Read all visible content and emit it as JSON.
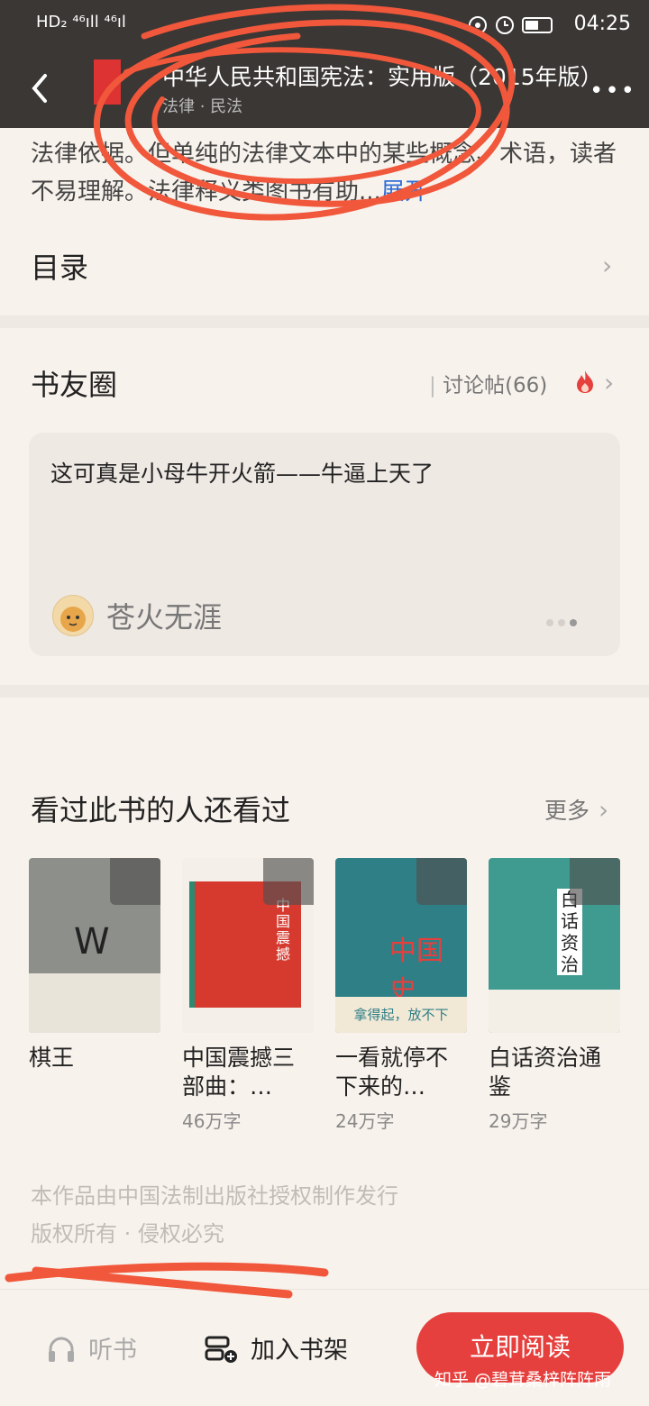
{
  "status_bar": {
    "left": "HD₂ ⁴⁶ıll ⁴⁶ıl",
    "time": "04:25",
    "icons": [
      "eye-icon",
      "alarm-icon",
      "battery-icon"
    ]
  },
  "header": {
    "title": "中华人民共和国宪法：实用版（2015年版）",
    "category": "法律 · 民法",
    "more_label": "•••"
  },
  "intro": {
    "text": "法律依据。但单纯的法律文本中的某些概念、术语，读者不易理解。法律释义类图书有助...",
    "expand_label": "展开"
  },
  "toc": {
    "label": "目录"
  },
  "book_circle": {
    "title": "书友圈",
    "discussion_label": "讨论帖(66)",
    "post": {
      "text": "这可真是小母牛开火箭——牛逼上天了",
      "user": "苍火无涯",
      "page_dots": 3,
      "active_dot": 2
    }
  },
  "recommendations": {
    "title": "看过此书的人还看过",
    "more_label": "更多",
    "books": [
      {
        "name": "棋王",
        "words": "",
        "cover_color": "#8d8f8b"
      },
      {
        "name": "中国震撼三部曲：…",
        "words": "46万字",
        "cover_color": "#d63a2f"
      },
      {
        "name": "一看就停不下来的…",
        "words": "24万字",
        "cover_color": "#2f7f86"
      },
      {
        "name": "白话资治通鉴",
        "words": "29万字",
        "cover_color": "#3f9a90"
      }
    ]
  },
  "copyright": {
    "line1": "本作品由中国法制出版社授权制作发行",
    "line2": "版权所有 · 侵权必究"
  },
  "bottom_bar": {
    "listen_label": "听书",
    "shelf_label": "加入书架",
    "read_label": "立即阅读"
  },
  "watermark": "知乎 @碧茸桑梓阵阵雨",
  "colors": {
    "accent": "#e5403d",
    "link": "#2f6fd8",
    "scribble": "#f0573b"
  }
}
